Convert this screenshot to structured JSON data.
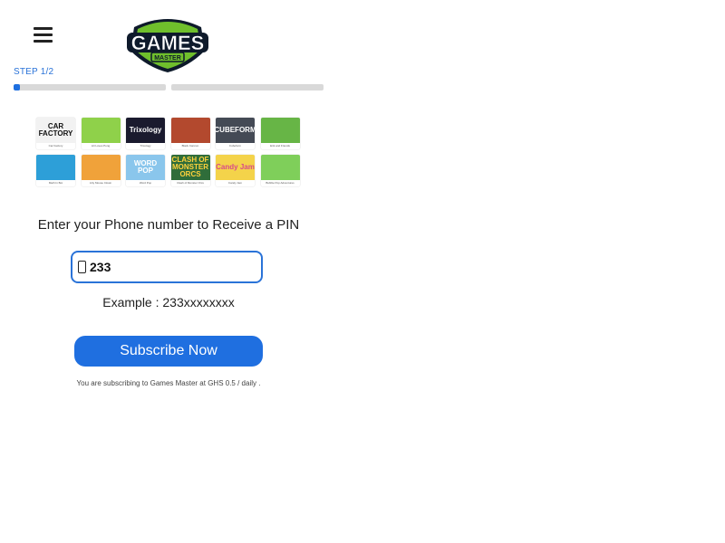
{
  "header": {
    "menu_icon": "hamburger-menu-icon",
    "logo": {
      "text": "GAMES",
      "subtext": "MASTER"
    }
  },
  "step": {
    "label": "STEP 1/2",
    "progress": [
      0.04,
      0.0
    ]
  },
  "games": [
    {
      "art": "CAR FACTORY",
      "caption": "Car Factory",
      "bg": "#f2f2f2",
      "fg": "#111"
    },
    {
      "art": "",
      "caption": "Lili Loves Pong",
      "bg": "#8fd14a",
      "fg": "#fff"
    },
    {
      "art": "Trixology",
      "caption": "Trixology",
      "bg": "#1a1a2e",
      "fg": "#fff"
    },
    {
      "art": "",
      "caption": "Black Cannon",
      "bg": "#b3492e",
      "fg": "#fff"
    },
    {
      "art": "CUBEFORM",
      "caption": "Cubeform",
      "bg": "#444a55",
      "fg": "#fff"
    },
    {
      "art": "",
      "caption": "Erik and Friends",
      "bg": "#67b546",
      "fg": "#fff"
    },
    {
      "art": "",
      "caption": "Math In Bot",
      "bg": "#2d9fd8",
      "fg": "#fff"
    },
    {
      "art": "",
      "caption": "Arty Mouse Clown",
      "bg": "#f0a23a",
      "fg": "#fff"
    },
    {
      "art": "WORD POP",
      "caption": "Word Pop",
      "bg": "#8ac6ec",
      "fg": "#fff"
    },
    {
      "art": "CLASH OF MONSTER ORCS",
      "caption": "Clash of Monster Orcs",
      "bg": "#2f6d3a",
      "fg": "#ffd23c"
    },
    {
      "art": "Candy Jam",
      "caption": "Candy Jam",
      "bg": "#f4d34a",
      "fg": "#d84a8a"
    },
    {
      "art": "",
      "caption": "Bubble Pop Adventures",
      "bg": "#7fcf5a",
      "fg": "#fff"
    }
  ],
  "form": {
    "prompt": "Enter your Phone number to Receive a PIN",
    "phone_value": "233",
    "example": "Example : 233xxxxxxxx",
    "subscribe_label": "Subscribe Now",
    "terms": "You are subscribing to Games Master at GHS 0.5 / daily ."
  },
  "colors": {
    "accent": "#1f6fe0",
    "progress_track": "#d9d9d9"
  }
}
